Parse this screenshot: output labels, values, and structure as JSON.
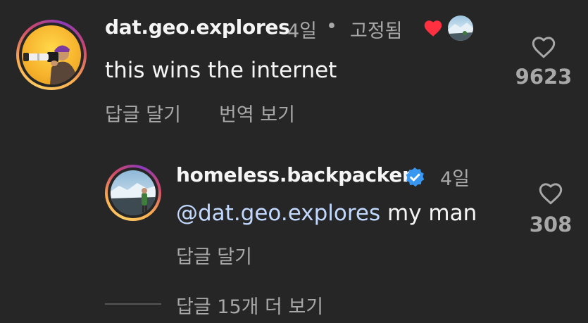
{
  "comment": {
    "username": "dat.geo.explores",
    "time": "4일",
    "separator": "•",
    "pinned": "고정됨",
    "author_liked_icon": "heart-filled-icon",
    "text": "this wins the internet",
    "reply_action": "답글 달기",
    "translate_action": "번역 보기",
    "like_icon": "heart-outline-icon",
    "like_count": "9623"
  },
  "reply": {
    "username": "homeless.backpacker",
    "verified_icon": "verified-badge-icon",
    "time": "4일",
    "mention": "@dat.geo.explores",
    "text": " my man",
    "reply_action": "답글 달기",
    "like_icon": "heart-outline-icon",
    "like_count": "308"
  },
  "view_more": {
    "label": "답글 15개 더 보기"
  },
  "colors": {
    "background": "#262626",
    "text": "#f5f5f5",
    "secondary": "#a8a8a8",
    "mention": "#c2d9ff",
    "heart_red": "#ff3040",
    "verified_blue": "#3897f0"
  }
}
